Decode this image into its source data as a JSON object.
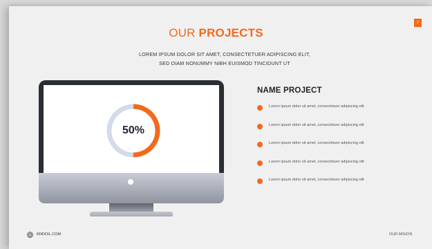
{
  "slide": {
    "page_number": "2",
    "title_light": "OUR ",
    "title_bold": "PROJECTS",
    "subtitle_line1": "LOREM IPSUM DOLOR SIT AMET, CONSECTETUER ADIPISCING ELIT,",
    "subtitle_line2": "SED DIAM NONUMMY NIBH EUISMOD TINCIDUNT UT"
  },
  "monitor": {
    "progress_label": "50%",
    "progress_fraction": 0.5
  },
  "project": {
    "heading": "NAME PROJECT",
    "items": [
      "Lorem ipsum dolor sit amet, consectetuer adipiscing elit",
      "Lorem ipsum dolor sit amet, consectetuer adipiscing elit",
      "Lorem ipsum dolor sit amet, consectetuer adipiscing elit",
      "Lorem ipsum dolor sit amet, consectetuer adipiscing elit",
      "Lorem ipsum dolor sit amet, consectetuer adipiscing elit"
    ]
  },
  "footer": {
    "website": "RNDOIL.COM",
    "section": "OUR MISION"
  },
  "colors": {
    "accent": "#f26a1b",
    "ring_track": "#d3dae8",
    "bezel": "#2a2d34"
  },
  "icons": {
    "footer_icon": "globe-icon"
  }
}
